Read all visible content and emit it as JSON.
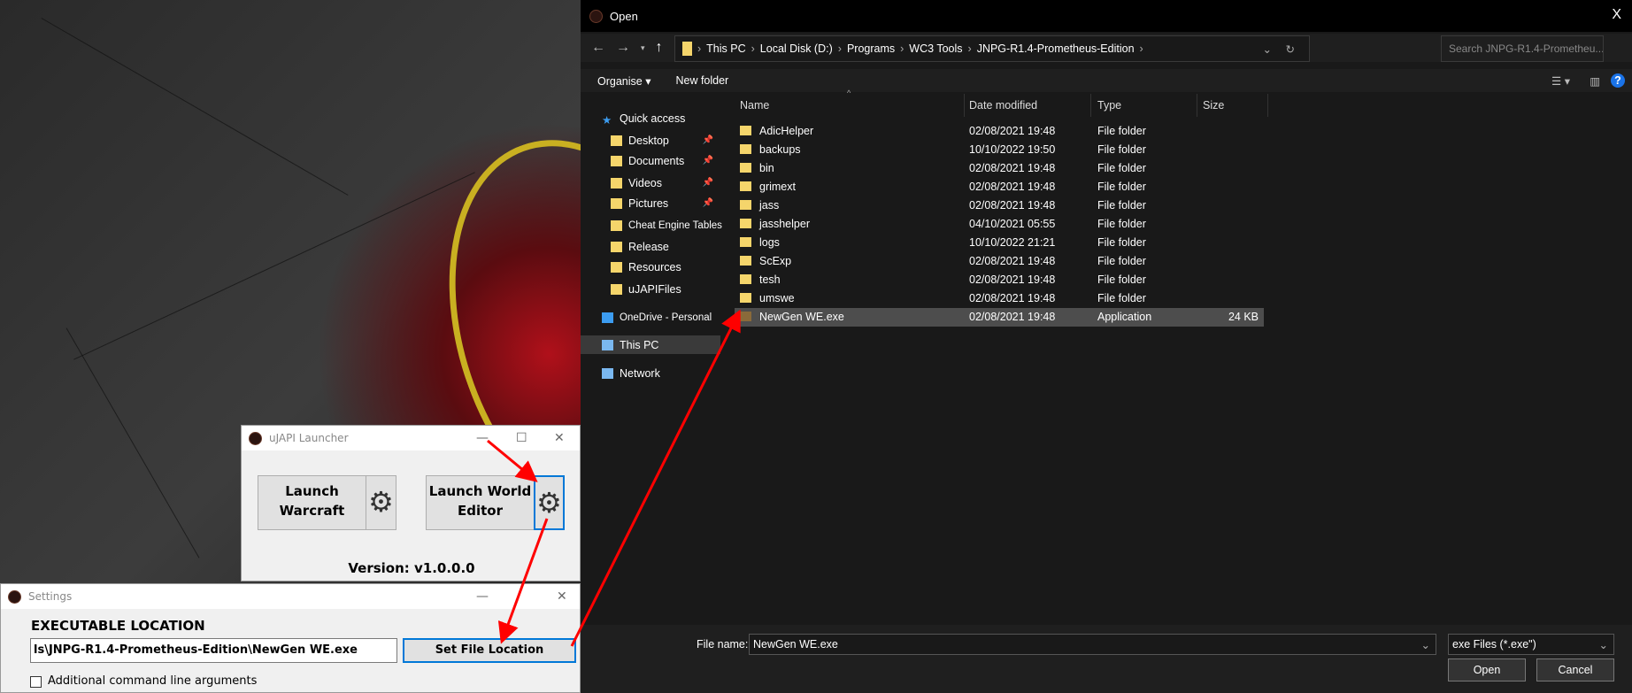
{
  "dialog": {
    "title": "Open",
    "close": "X",
    "breadcrumbs": [
      "This PC",
      "Local Disk (D:)",
      "Programs",
      "WC3 Tools",
      "JNPG-R1.4-Prometheus-Edition"
    ],
    "search_placeholder": "Search JNPG-R1.4-Prometheu...",
    "toolbar": {
      "organise": "Organise ▾",
      "new_folder": "New folder"
    },
    "columns": [
      "Name",
      "Date modified",
      "Type",
      "Size"
    ],
    "sidebar": [
      {
        "label": "Quick access",
        "icon": "star-icon",
        "pinned": false
      },
      {
        "label": "Desktop",
        "icon": "folder-icon",
        "pinned": true
      },
      {
        "label": "Documents",
        "icon": "folder-icon",
        "pinned": true
      },
      {
        "label": "Videos",
        "icon": "folder-icon",
        "pinned": true
      },
      {
        "label": "Pictures",
        "icon": "folder-icon",
        "pinned": true
      },
      {
        "label": "Cheat Engine Tables",
        "icon": "folder-icon",
        "pinned": false
      },
      {
        "label": "Release",
        "icon": "folder-icon",
        "pinned": false
      },
      {
        "label": "Resources",
        "icon": "folder-icon",
        "pinned": false
      },
      {
        "label": "uJAPIFiles",
        "icon": "folder-icon",
        "pinned": false
      },
      {
        "label": "OneDrive - Personal",
        "icon": "cloud-icon",
        "pinned": false
      },
      {
        "label": "This PC",
        "icon": "computer-icon",
        "pinned": false,
        "selected": true
      },
      {
        "label": "Network",
        "icon": "network-icon",
        "pinned": false
      }
    ],
    "files": [
      {
        "name": "AdicHelper",
        "date": "02/08/2021 19:48",
        "type": "File folder",
        "size": ""
      },
      {
        "name": "backups",
        "date": "10/10/2022 19:50",
        "type": "File folder",
        "size": ""
      },
      {
        "name": "bin",
        "date": "02/08/2021 19:48",
        "type": "File folder",
        "size": ""
      },
      {
        "name": "grimext",
        "date": "02/08/2021 19:48",
        "type": "File folder",
        "size": ""
      },
      {
        "name": "jass",
        "date": "02/08/2021 19:48",
        "type": "File folder",
        "size": ""
      },
      {
        "name": "jasshelper",
        "date": "04/10/2021 05:55",
        "type": "File folder",
        "size": ""
      },
      {
        "name": "logs",
        "date": "10/10/2022 21:21",
        "type": "File folder",
        "size": ""
      },
      {
        "name": "ScExp",
        "date": "02/08/2021 19:48",
        "type": "File folder",
        "size": ""
      },
      {
        "name": "tesh",
        "date": "02/08/2021 19:48",
        "type": "File folder",
        "size": ""
      },
      {
        "name": "umswe",
        "date": "02/08/2021 19:48",
        "type": "File folder",
        "size": ""
      },
      {
        "name": "NewGen WE.exe",
        "date": "02/08/2021 19:48",
        "type": "Application",
        "size": "24 KB",
        "selected": true
      }
    ],
    "file_name_label": "File name:",
    "file_name_value": "NewGen WE.exe",
    "filter": "exe Files (*.exe\")",
    "open": "Open",
    "cancel": "Cancel"
  },
  "launcher": {
    "title": "uJAPI Launcher",
    "launch_warcraft": "Launch Warcraft",
    "launch_we": "Launch World Editor",
    "version": "Version: v1.0.0.0"
  },
  "settings": {
    "title": "Settings",
    "heading": "EXECUTABLE LOCATION",
    "path": "ls\\JNPG-R1.4-Prometheus-Edition\\NewGen WE.exe",
    "set_button": "Set File Location",
    "checkbox_label": "Additional command line arguments"
  },
  "colors": {
    "arrow": "#ff0000",
    "accent": "#0078d7"
  }
}
